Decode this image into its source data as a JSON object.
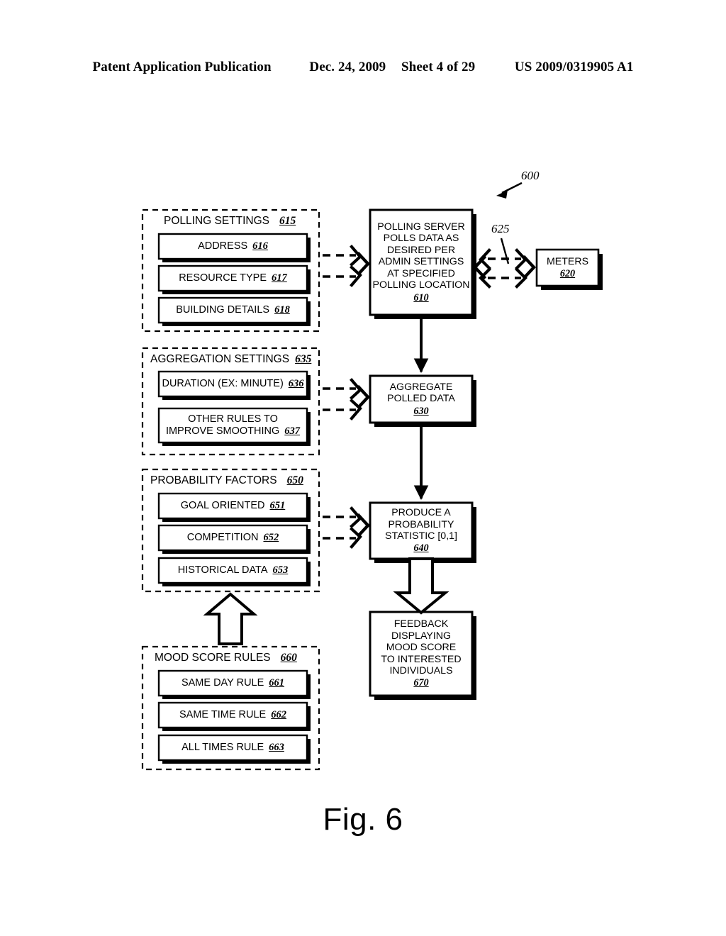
{
  "header": {
    "publication": "Patent Application Publication",
    "date": "Dec. 24, 2009",
    "sheet": "Sheet 4 of 29",
    "number": "US 2009/0319905 A1"
  },
  "figure": {
    "caption": "Fig. 6",
    "diagram_ref": "600"
  },
  "groups": [
    {
      "id": "polling-settings",
      "title": "POLLING SETTINGS",
      "ref": "615",
      "items": [
        {
          "label": "ADDRESS",
          "ref": "616"
        },
        {
          "label": "RESOURCE TYPE",
          "ref": "617"
        },
        {
          "label": "BUILDING DETAILS",
          "ref": "618"
        }
      ]
    },
    {
      "id": "aggregation-settings",
      "title": "AGGREGATION SETTINGS",
      "ref": "635",
      "items": [
        {
          "label": "DURATION (EX: MINUTE)",
          "ref": "636"
        },
        {
          "label": "OTHER RULES TO IMPROVE SMOOTHING",
          "line1": "OTHER RULES TO",
          "line2": "IMPROVE SMOOTHING",
          "ref": "637"
        }
      ]
    },
    {
      "id": "probability-factors",
      "title": "PROBABILITY FACTORS",
      "ref": "650",
      "items": [
        {
          "label": "GOAL ORIENTED",
          "ref": "651"
        },
        {
          "label": "COMPETITION",
          "ref": "652"
        },
        {
          "label": "HISTORICAL DATA",
          "ref": "653"
        }
      ]
    },
    {
      "id": "mood-score-rules",
      "title": "MOOD SCORE RULES",
      "ref": "660",
      "items": [
        {
          "label": "SAME DAY RULE",
          "ref": "661"
        },
        {
          "label": "SAME TIME RULE",
          "ref": "662"
        },
        {
          "label": "ALL TIMES RULE",
          "ref": "663"
        }
      ]
    }
  ],
  "nodes": {
    "polling_server": {
      "lines": [
        "POLLING SERVER",
        "POLLS DATA AS",
        "DESIRED PER",
        "ADMIN SETTINGS",
        "AT SPECIFIED",
        "POLLING LOCATION"
      ],
      "ref": "610"
    },
    "meters": {
      "lines": [
        "METERS"
      ],
      "ref": "620"
    },
    "aggregate": {
      "lines": [
        "AGGREGATE",
        "POLLED DATA"
      ],
      "ref": "630"
    },
    "probability": {
      "lines": [
        "PRODUCE A",
        "PROBABILITY",
        "STATISTIC [0,1]"
      ],
      "ref": "640"
    },
    "feedback": {
      "lines": [
        "FEEDBACK",
        "DISPLAYING",
        "MOOD SCORE",
        "TO INTERESTED",
        "INDIVIDUALS"
      ],
      "ref": "670"
    }
  },
  "connectors": {
    "meters_link_ref": "625"
  },
  "colors": {
    "ink": "#000000",
    "paper": "#ffffff"
  }
}
